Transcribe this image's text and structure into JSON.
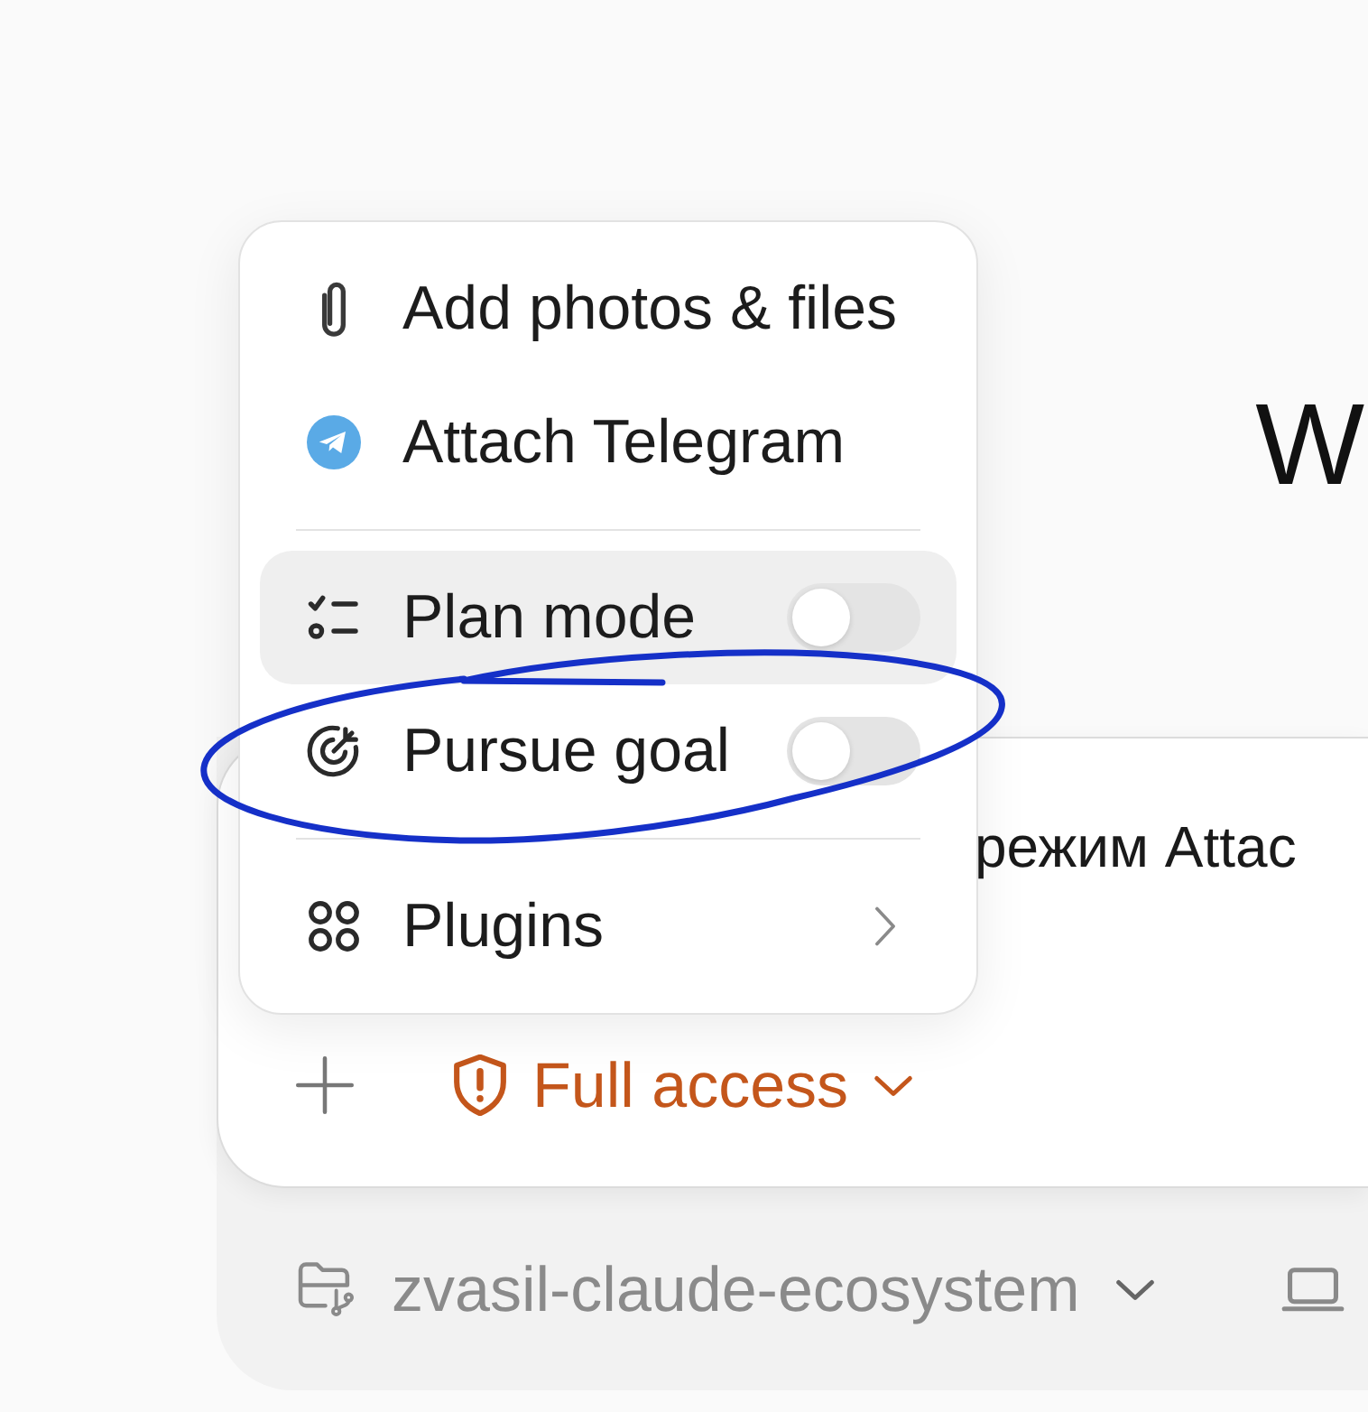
{
  "heading": "W",
  "menu": {
    "groups": [
      {
        "items": [
          {
            "kind": "action",
            "label": "Add photos & files",
            "selected": false
          },
          {
            "kind": "action",
            "label": "Attach Telegram",
            "selected": false
          }
        ]
      },
      {
        "items": [
          {
            "kind": "toggle",
            "label": "Plan mode",
            "selected": true,
            "on": false
          },
          {
            "kind": "toggle",
            "label": "Pursue goal",
            "selected": false,
            "on": false
          }
        ]
      },
      {
        "items": [
          {
            "kind": "submenu",
            "label": "Plugins",
            "selected": false
          }
        ]
      }
    ]
  },
  "composer": {
    "value": "режим Attac",
    "access": {
      "label": "Full access"
    }
  },
  "footer": {
    "project": "zvasil-claude-ecosystem"
  }
}
